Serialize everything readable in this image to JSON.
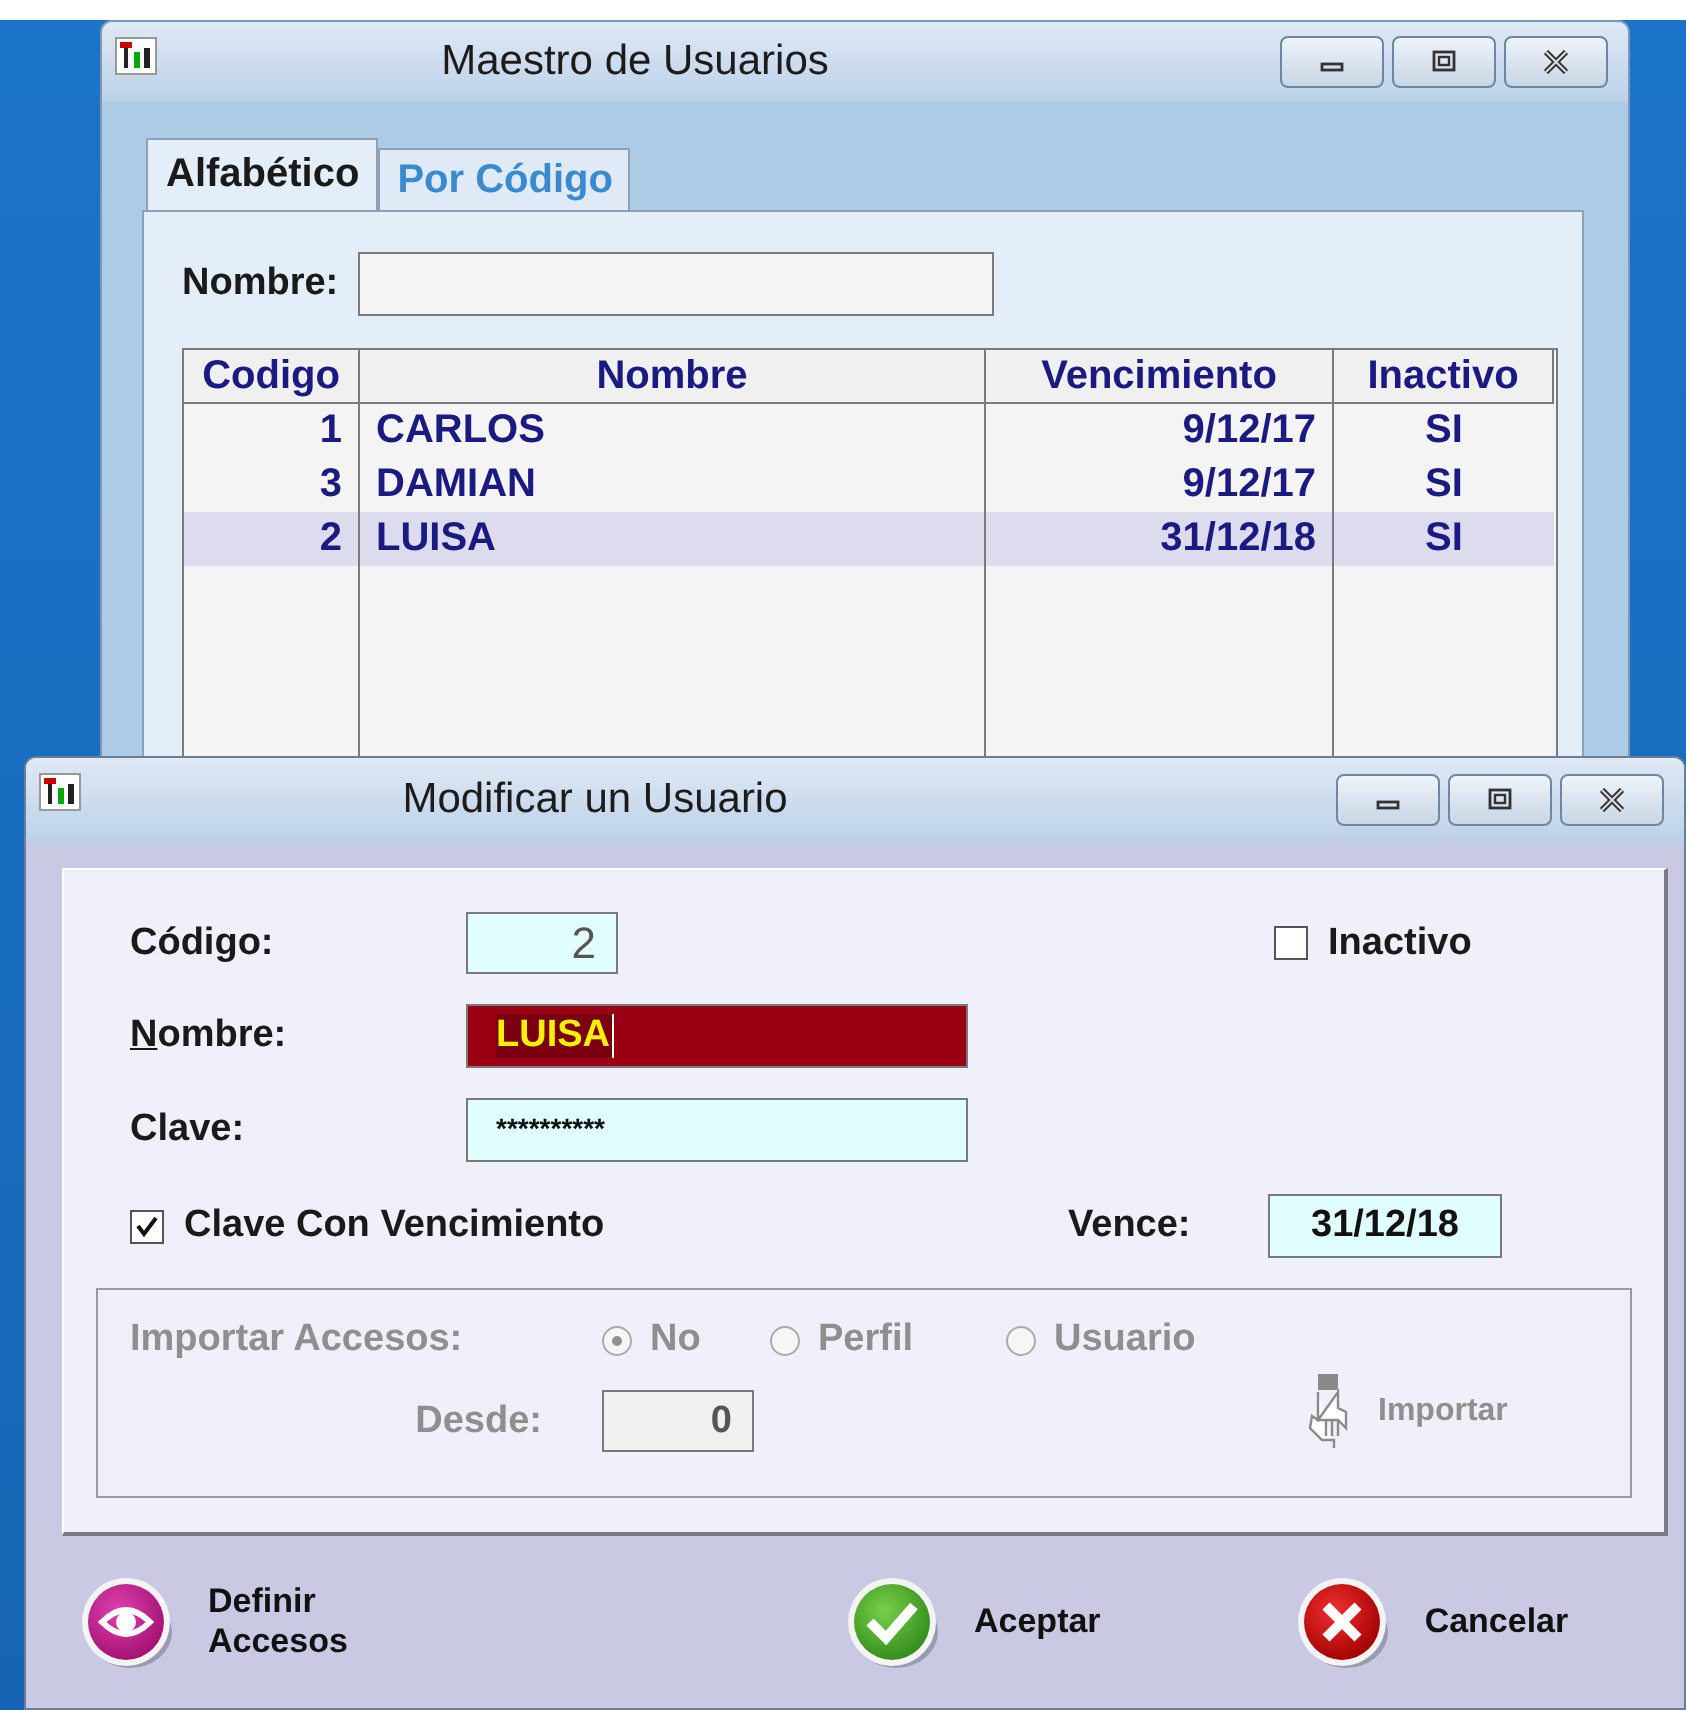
{
  "background_window": {
    "title": "Maestro de Usuarios",
    "tabs": [
      {
        "label": "Alfabético",
        "selected": true
      },
      {
        "label": "Por Código",
        "selected": false
      }
    ],
    "search": {
      "label": "Nombre:"
    },
    "table": {
      "columns": [
        "Codigo",
        "Nombre",
        "Vencimiento",
        "Inactivo"
      ],
      "rows": [
        {
          "cells": [
            "1",
            "CARLOS",
            "9/12/17",
            "SI"
          ],
          "selected": false
        },
        {
          "cells": [
            "3",
            "DAMIAN",
            "9/12/17",
            "SI"
          ],
          "selected": false
        },
        {
          "cells": [
            "2",
            "LUISA",
            "31/12/18",
            "SI"
          ],
          "selected": true
        }
      ]
    }
  },
  "dialog": {
    "title": "Modificar un Usuario",
    "codigo": {
      "label": "Código:",
      "value": "2"
    },
    "inactivo": {
      "label": "Inactivo",
      "checked": false
    },
    "nombre": {
      "label": "Nombre:",
      "mnemonic": true,
      "value": "LUISA",
      "focused": true
    },
    "clave": {
      "label": "Clave:",
      "value": "**********"
    },
    "vencimiento": {
      "label": "Clave Con Vencimiento",
      "checked": true
    },
    "vence": {
      "label": "Vence:",
      "value": "31/12/18"
    },
    "import_group": {
      "disabled": true,
      "label": "Importar Accesos:",
      "options": [
        {
          "label": "No",
          "selected": true
        },
        {
          "label": "Perfil",
          "selected": false
        },
        {
          "label": "Usuario",
          "selected": false
        }
      ],
      "desde": {
        "label": "Desde:",
        "value": "0"
      },
      "button": "Importar"
    },
    "buttons": [
      {
        "kind": "access",
        "label": "Definir Accesos"
      },
      {
        "kind": "accept",
        "label": "Aceptar"
      },
      {
        "kind": "cancel",
        "label": "Cancelar"
      }
    ]
  }
}
